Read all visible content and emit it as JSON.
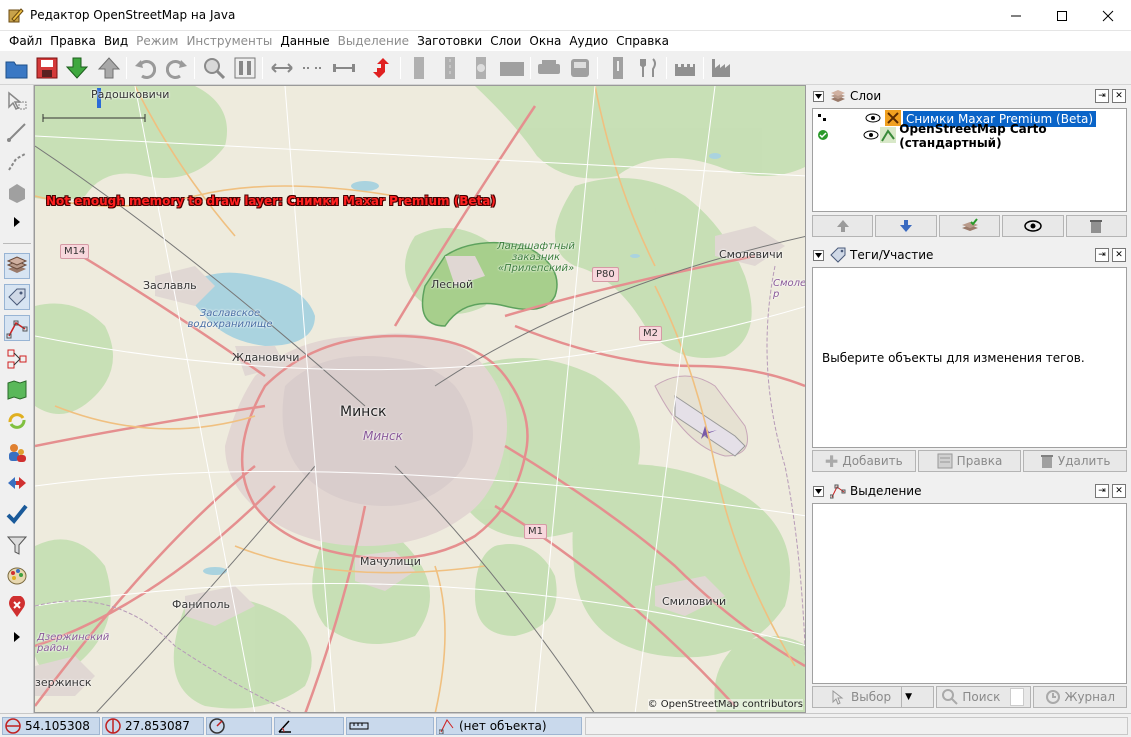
{
  "window": {
    "title": "Редактор OpenStreetMap на Java",
    "minimize": "—",
    "maximize": "☐",
    "close": "✕"
  },
  "menu": [
    {
      "label": "Файл",
      "enabled": true
    },
    {
      "label": "Правка",
      "enabled": true
    },
    {
      "label": "Вид",
      "enabled": true
    },
    {
      "label": "Режим",
      "enabled": false
    },
    {
      "label": "Инструменты",
      "enabled": false
    },
    {
      "label": "Данные",
      "enabled": true
    },
    {
      "label": "Выделение",
      "enabled": false
    },
    {
      "label": "Заготовки",
      "enabled": true
    },
    {
      "label": "Слои",
      "enabled": true
    },
    {
      "label": "Окна",
      "enabled": true
    },
    {
      "label": "Аудио",
      "enabled": true
    },
    {
      "label": "Справка",
      "enabled": true
    }
  ],
  "map": {
    "warning": "Not enough memory to draw layer: Снимки Maxar Premium (Beta)",
    "attribution": "© OpenStreetMap contributors",
    "scale_label": "Радошковичи",
    "labels": {
      "zaslavl": "Заславль",
      "reservoir": "Заславское водохранилище",
      "zhdanovichi": "Ждановичи",
      "minsk": "Минск",
      "minsk_sub": "Минск",
      "lesnoy": "Лесной",
      "reserve": "Ландшафтный заказник «Прилепский»",
      "smolevichi": "Смолевичи",
      "smol_edge": "Смоле р",
      "machulishchi": "Мачулищи",
      "fanipol": "Фаниполь",
      "smilovichi": "Смиловичи",
      "dzerzhinsk_district": "Дзержинский район",
      "dzerzhinsk": "зержинск"
    },
    "shields": {
      "m14": "M14",
      "p80": "P80",
      "m2": "M2",
      "m1": "M1"
    }
  },
  "panels": {
    "layers": {
      "title": "Слои",
      "rows": [
        {
          "name": "Снимки Maxar Premium (Beta)",
          "selected": true,
          "active": false
        },
        {
          "name": "OpenStreetMap Carto (стандартный)",
          "selected": false,
          "active": true
        }
      ]
    },
    "tags": {
      "title": "Теги/Участие",
      "empty_text": "Выберите объекты для изменения тегов.",
      "add": "Добавить",
      "edit": "Правка",
      "delete": "Удалить"
    },
    "selection": {
      "title": "Выделение",
      "select": "Выбор",
      "search": "Поиск",
      "history": "Журнал"
    }
  },
  "status": {
    "lat": "54.105308",
    "lon": "27.853087",
    "object": "(нет объекта)"
  }
}
